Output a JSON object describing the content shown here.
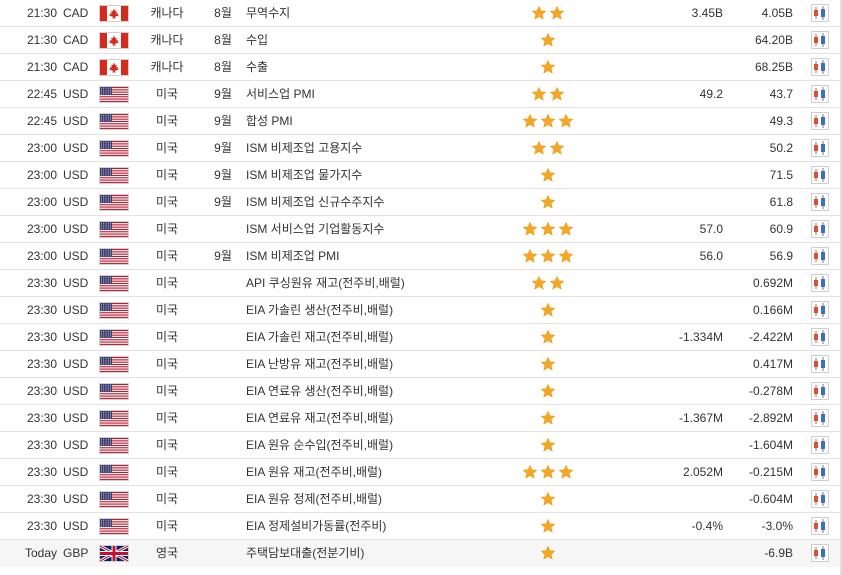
{
  "events": [
    {
      "time": "21:30",
      "currency": "CAD",
      "flag": "ca-flag",
      "country": "캐나다",
      "period": "8월",
      "name": "무역수지",
      "importance": 2,
      "forecast": "3.45B",
      "previous": "4.05B"
    },
    {
      "time": "21:30",
      "currency": "CAD",
      "flag": "ca-flag",
      "country": "캐나다",
      "period": "8월",
      "name": "수입",
      "importance": 1,
      "forecast": "",
      "previous": "64.20B"
    },
    {
      "time": "21:30",
      "currency": "CAD",
      "flag": "ca-flag",
      "country": "캐나다",
      "period": "8월",
      "name": "수출",
      "importance": 1,
      "forecast": "",
      "previous": "68.25B"
    },
    {
      "time": "22:45",
      "currency": "USD",
      "flag": "us-flag",
      "country": "미국",
      "period": "9월",
      "name": "서비스업 PMI",
      "importance": 2,
      "forecast": "49.2",
      "previous": "43.7"
    },
    {
      "time": "22:45",
      "currency": "USD",
      "flag": "us-flag",
      "country": "미국",
      "period": "9월",
      "name": "합성 PMI",
      "importance": 3,
      "forecast": "",
      "previous": "49.3"
    },
    {
      "time": "23:00",
      "currency": "USD",
      "flag": "us-flag",
      "country": "미국",
      "period": "9월",
      "name": "ISM 비제조업 고용지수",
      "importance": 2,
      "forecast": "",
      "previous": "50.2"
    },
    {
      "time": "23:00",
      "currency": "USD",
      "flag": "us-flag",
      "country": "미국",
      "period": "9월",
      "name": "ISM 비제조업 물가지수",
      "importance": 1,
      "forecast": "",
      "previous": "71.5"
    },
    {
      "time": "23:00",
      "currency": "USD",
      "flag": "us-flag",
      "country": "미국",
      "period": "9월",
      "name": "ISM 비제조업 신규수주지수",
      "importance": 1,
      "forecast": "",
      "previous": "61.8"
    },
    {
      "time": "23:00",
      "currency": "USD",
      "flag": "us-flag",
      "country": "미국",
      "period": "",
      "name": "ISM 서비스업 기업활동지수",
      "importance": 3,
      "forecast": "57.0",
      "previous": "60.9"
    },
    {
      "time": "23:00",
      "currency": "USD",
      "flag": "us-flag",
      "country": "미국",
      "period": "9월",
      "name": "ISM 비제조업 PMI",
      "importance": 3,
      "forecast": "56.0",
      "previous": "56.9"
    },
    {
      "time": "23:30",
      "currency": "USD",
      "flag": "us-flag",
      "country": "미국",
      "period": "",
      "name": "API 쿠싱원유 재고(전주비,배럴)",
      "importance": 2,
      "forecast": "",
      "previous": "0.692M"
    },
    {
      "time": "23:30",
      "currency": "USD",
      "flag": "us-flag",
      "country": "미국",
      "period": "",
      "name": "EIA 가솔린 생산(전주비,배럴)",
      "importance": 1,
      "forecast": "",
      "previous": "0.166M"
    },
    {
      "time": "23:30",
      "currency": "USD",
      "flag": "us-flag",
      "country": "미국",
      "period": "",
      "name": "EIA 가솔린 재고(전주비,배럴)",
      "importance": 1,
      "forecast": "-1.334M",
      "previous": "-2.422M"
    },
    {
      "time": "23:30",
      "currency": "USD",
      "flag": "us-flag",
      "country": "미국",
      "period": "",
      "name": "EIA 난방유 재고(전주비,배럴)",
      "importance": 1,
      "forecast": "",
      "previous": "0.417M"
    },
    {
      "time": "23:30",
      "currency": "USD",
      "flag": "us-flag",
      "country": "미국",
      "period": "",
      "name": "EIA 연료유 생산(전주비,배럴)",
      "importance": 1,
      "forecast": "",
      "previous": "-0.278M"
    },
    {
      "time": "23:30",
      "currency": "USD",
      "flag": "us-flag",
      "country": "미국",
      "period": "",
      "name": "EIA 연료유 재고(전주비,배럴)",
      "importance": 1,
      "forecast": "-1.367M",
      "previous": "-2.892M"
    },
    {
      "time": "23:30",
      "currency": "USD",
      "flag": "us-flag",
      "country": "미국",
      "period": "",
      "name": "EIA 원유 순수입(전주비,배럴)",
      "importance": 1,
      "forecast": "",
      "previous": "-1.604M"
    },
    {
      "time": "23:30",
      "currency": "USD",
      "flag": "us-flag",
      "country": "미국",
      "period": "",
      "name": "EIA 원유 재고(전주비,배럴)",
      "importance": 3,
      "forecast": "2.052M",
      "previous": "-0.215M"
    },
    {
      "time": "23:30",
      "currency": "USD",
      "flag": "us-flag",
      "country": "미국",
      "period": "",
      "name": "EIA 원유 정제(전주비,배럴)",
      "importance": 1,
      "forecast": "",
      "previous": "-0.604M"
    },
    {
      "time": "23:30",
      "currency": "USD",
      "flag": "us-flag",
      "country": "미국",
      "period": "",
      "name": "EIA 정제설비가동률(전주비)",
      "importance": 1,
      "forecast": "-0.4%",
      "previous": "-3.0%"
    },
    {
      "time": "Today",
      "currency": "GBP",
      "flag": "uk-flag",
      "country": "영국",
      "period": "",
      "name": "주택담보대출(전분기비)",
      "importance": 1,
      "forecast": "",
      "previous": "-6.9B"
    }
  ],
  "icons": {
    "importance": "star-icon",
    "chart": "chart-icon"
  },
  "colors": {
    "star": "#f5a623",
    "chart_red": "#e04b3a",
    "chart_blue": "#3b6fc4",
    "row_border": "#e3e3e3",
    "text": "#333333"
  }
}
